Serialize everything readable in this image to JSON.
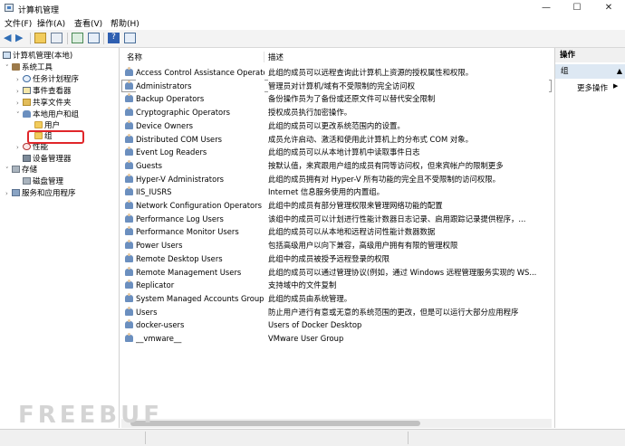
{
  "window": {
    "title": "计算机管理",
    "minimize": "—",
    "maximize": "☐",
    "close": "✕"
  },
  "menu": [
    "文件(F)",
    "操作(A)",
    "查看(V)",
    "帮助(H)"
  ],
  "tree": {
    "root": "计算机管理(本地)",
    "system_tools": "系统工具",
    "task_scheduler": "任务计划程序",
    "event_viewer": "事件查看器",
    "shared_folders": "共享文件夹",
    "local_users_groups": "本地用户和组",
    "users": "用户",
    "groups": "组",
    "performance": "性能",
    "device_manager": "设备管理器",
    "storage": "存储",
    "disk_management": "磁盘管理",
    "services_apps": "服务和应用程序"
  },
  "list": {
    "header_name": "名称",
    "header_desc": "描述",
    "rows": [
      {
        "name": "Access Control Assistance Operators",
        "desc": "此组的成员可以远程查询此计算机上资源的授权属性和权限。"
      },
      {
        "name": "Administrators",
        "desc": "管理员对计算机/域有不受限制的完全访问权"
      },
      {
        "name": "Backup Operators",
        "desc": "备份操作员为了备份或还原文件可以替代安全限制"
      },
      {
        "name": "Cryptographic Operators",
        "desc": "授权成员执行加密操作。"
      },
      {
        "name": "Device Owners",
        "desc": "此组的成员可以更改系统范围内的设置。"
      },
      {
        "name": "Distributed COM Users",
        "desc": "成员允许启动、激活和使用此计算机上的分布式 COM 对象。"
      },
      {
        "name": "Event Log Readers",
        "desc": "此组的成员可以从本地计算机中读取事件日志"
      },
      {
        "name": "Guests",
        "desc": "按默认值，来宾跟用户组的成员有同等访问权，但来宾帐户的限制更多"
      },
      {
        "name": "Hyper-V Administrators",
        "desc": "此组的成员拥有对 Hyper-V 所有功能的完全且不受限制的访问权限。"
      },
      {
        "name": "IIS_IUSRS",
        "desc": "Internet 信息服务使用的内置组。"
      },
      {
        "name": "Network Configuration Operators",
        "desc": "此组中的成员有部分管理权限来管理网络功能的配置"
      },
      {
        "name": "Performance Log Users",
        "desc": "该组中的成员可以计划进行性能计数器日志记录、启用跟踪记录提供程序，..."
      },
      {
        "name": "Performance Monitor Users",
        "desc": "此组的成员可以从本地和远程访问性能计数器数据"
      },
      {
        "name": "Power Users",
        "desc": "包括高级用户以向下兼容，高级用户拥有有限的管理权限"
      },
      {
        "name": "Remote Desktop Users",
        "desc": "此组中的成员被授予远程登录的权限"
      },
      {
        "name": "Remote Management Users",
        "desc": "此组的成员可以通过管理协议(例如，通过 Windows 远程管理服务实现的 WS..."
      },
      {
        "name": "Replicator",
        "desc": "支持域中的文件复制"
      },
      {
        "name": "System Managed Accounts Group",
        "desc": "此组的成员由系统管理。"
      },
      {
        "name": "Users",
        "desc": "防止用户进行有意或无意的系统范围的更改，但是可以运行大部分应用程序"
      },
      {
        "name": "docker-users",
        "desc": "Users of Docker Desktop"
      },
      {
        "name": "__vmware__",
        "desc": "VMware User Group"
      }
    ]
  },
  "actions": {
    "header": "操作",
    "section": "组",
    "more": "更多操作"
  },
  "watermark": "FREEBUF"
}
